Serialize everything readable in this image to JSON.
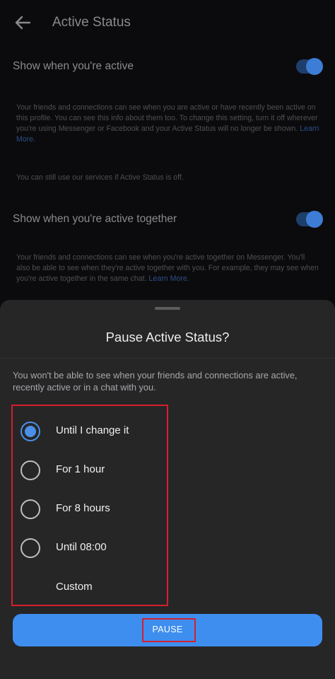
{
  "header": {
    "title": "Active Status",
    "back_icon": "arrow-left-icon"
  },
  "settings": {
    "show_active": {
      "label": "Show when you're active",
      "enabled": true,
      "description": "Your friends and connections can see when you are active or have recently been active on this profile. You can see this info about them too. To change this setting, turn it off wherever you're using Messenger or Facebook and your Active Status will no longer be shown.",
      "link": "Learn More."
    },
    "services_note": "You can still use our services if Active Status is off.",
    "show_together": {
      "label": "Show when you're active together",
      "enabled": true,
      "description": "Your friends and connections can see when you're active together on Messenger. You'll also be able to see when they're active together with you. For example, they may see when you're active together in the same chat.",
      "link": "Learn More."
    }
  },
  "sheet": {
    "title": "Pause Active Status?",
    "description": "You won't be able to see when your friends and connections are active, recently active or in a chat with you.",
    "options": [
      {
        "label": "Until I change it",
        "selected": true
      },
      {
        "label": "For 1 hour",
        "selected": false
      },
      {
        "label": "For 8 hours",
        "selected": false
      },
      {
        "label": "Until 08:00",
        "selected": false
      },
      {
        "label": "Custom",
        "selected": false
      }
    ],
    "pause_label": "PAUSE"
  },
  "colors": {
    "accent": "#3e8ef0",
    "highlight_box": "#d4202c",
    "sheet_bg": "#262627"
  }
}
